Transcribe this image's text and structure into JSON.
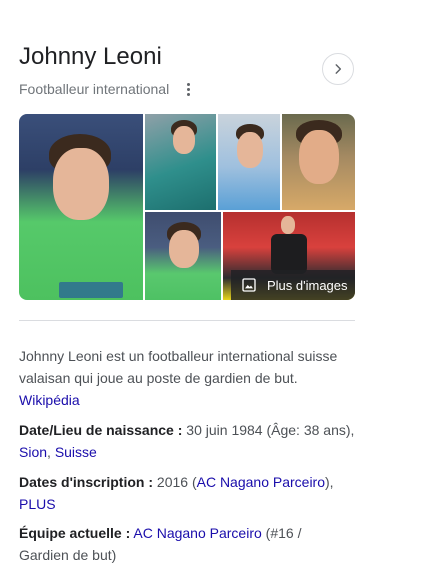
{
  "header": {
    "title": "Johnny Leoni",
    "subtitle": "Footballeur international"
  },
  "gallery": {
    "more_images_label": "Plus d'images"
  },
  "description": {
    "text": "Johnny Leoni est un footballeur international suisse valaisan qui joue au poste de gardien de but.",
    "source_link": "Wikipédia"
  },
  "facts": {
    "birth": {
      "label": "Date/Lieu de naissance :",
      "value": "30 juin 1984 (Âge: 38 ans),",
      "place_link_1": "Sion",
      "separator": ", ",
      "place_link_2": "Suisse"
    },
    "inscription": {
      "label": "Dates d'inscription :",
      "value_prefix": "2016 (",
      "club_link": "AC Nagano Parceiro",
      "value_suffix": "),",
      "more_link": "PLUS"
    },
    "current_team": {
      "label": "Équipe actuelle :",
      "club_link": "AC Nagano Parceiro",
      "value_suffix": " (#16 /",
      "value_line2": "Gardien de but)"
    }
  },
  "colors": {
    "link": "#1a0dab",
    "text": "#4d5156",
    "title": "#202124",
    "muted": "#70757a"
  }
}
